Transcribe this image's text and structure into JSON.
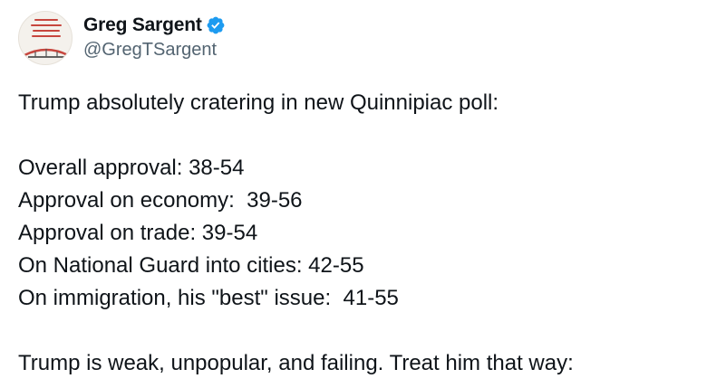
{
  "author": {
    "display_name": "Greg Sargent",
    "handle": "@GregTSargent",
    "verified_icon": "verified-badge-icon",
    "avatar_caption": "TAKING BACK OUR DEMOCRACY IN AN AGE OF TRUMPIAN DISINFORMATION AND THUNDERDOME POLITICS"
  },
  "tweet": {
    "lines": [
      "Trump absolutely cratering in new Quinnipiac poll:",
      "",
      "Overall approval: 38-54",
      "Approval on economy:  39-56",
      "Approval on trade: 39-54",
      "On National Guard into cities: 42-55",
      "On immigration, his \"best\" issue:  41-55",
      "",
      "Trump is weak, unpopular, and failing. Treat him that way:"
    ]
  },
  "colors": {
    "text": "#0f1419",
    "secondary": "#536471",
    "verified": "#1d9bf0",
    "avatar_accent": "#c7463e"
  }
}
